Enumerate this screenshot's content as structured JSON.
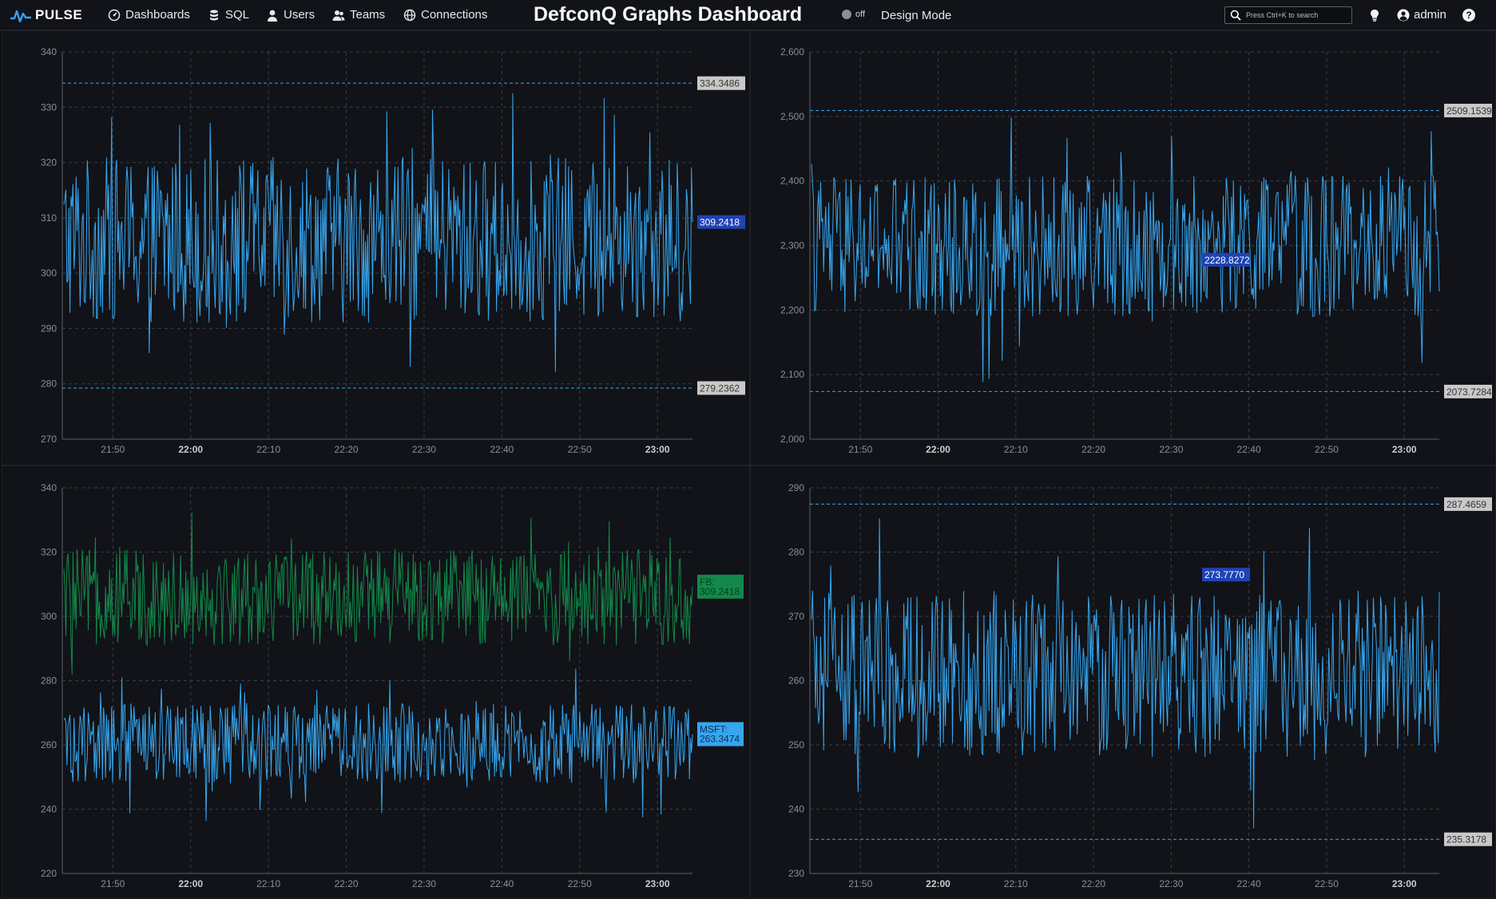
{
  "app": {
    "logo_text": "PULSE",
    "nav": [
      {
        "label": "Dashboards",
        "icon": "dashboard-icon"
      },
      {
        "label": "SQL",
        "icon": "database-icon"
      },
      {
        "label": "Users",
        "icon": "user-icon"
      },
      {
        "label": "Teams",
        "icon": "teams-icon"
      },
      {
        "label": "Connections",
        "icon": "globe-icon"
      }
    ],
    "title": "DefconQ Graphs Dashboard",
    "design_toggle_state": "off",
    "design_mode_label": "Design Mode",
    "search_placeholder": "Press Ctrl+K to search",
    "user_name": "admin",
    "colors": {
      "background": "#0e1014",
      "panel": "#111318",
      "series_blue": "#37a6ef",
      "series_green": "#12894a",
      "label_blue": "#1f43b5",
      "label_grey": "#c9c9c9"
    }
  },
  "chart_data": [
    {
      "type": "line",
      "x_ticks": [
        "21:50",
        "22:00",
        "22:10",
        "22:20",
        "22:30",
        "22:40",
        "22:50",
        "23:00"
      ],
      "x_bold_ticks": [
        "22:00",
        "23:00"
      ],
      "x_range": [
        "21:43:30",
        "23:04:30"
      ],
      "ylim": [
        270,
        340
      ],
      "y_ticks": [
        340,
        330,
        320,
        310,
        300,
        290,
        280,
        270
      ],
      "grid": true,
      "series": [
        {
          "color": "#37a6ef",
          "band": [
            291,
            321
          ],
          "spike_max": 334.3486,
          "spike_min": 279.2362,
          "last": 309.2418
        }
      ],
      "hlines": [
        334.3486,
        279.2362
      ],
      "labels": [
        {
          "value": 334.3486,
          "text": "334.3486",
          "style": "grey"
        },
        {
          "value": 309.2418,
          "text": "309.2418",
          "style": "blue"
        },
        {
          "value": 279.2362,
          "text": "279.2362",
          "style": "grey"
        }
      ]
    },
    {
      "type": "line",
      "x_ticks": [
        "21:50",
        "22:00",
        "22:10",
        "22:20",
        "22:30",
        "22:40",
        "22:50",
        "23:00"
      ],
      "x_bold_ticks": [
        "22:00",
        "23:00"
      ],
      "x_range": [
        "21:43:30",
        "23:04:30"
      ],
      "ylim": [
        2000,
        2600
      ],
      "y_ticks": [
        "2,600",
        "2,500",
        "2,400",
        "2,300",
        "2,200",
        "2,100",
        "2,000"
      ],
      "grid": true,
      "series": [
        {
          "color": "#37a6ef",
          "band": [
            2190,
            2410
          ],
          "spike_max": 2509.1539,
          "spike_min": 2073.7284,
          "last": 2228.8272
        }
      ],
      "hlines": [
        2509.1539,
        2073.7284
      ],
      "labels": [
        {
          "value": 2509.1539,
          "text": "2509.1539",
          "style": "grey"
        },
        {
          "value": 2073.7284,
          "text": "2073.7284",
          "style": "grey"
        },
        {
          "value": 2278,
          "time": "22:35",
          "text": "2228.8272",
          "style": "blue"
        }
      ]
    },
    {
      "type": "line",
      "x_ticks": [
        "21:50",
        "22:00",
        "22:10",
        "22:20",
        "22:30",
        "22:40",
        "22:50",
        "23:00"
      ],
      "x_bold_ticks": [
        "22:00",
        "23:00"
      ],
      "x_range": [
        "21:43:30",
        "23:04:30"
      ],
      "ylim": [
        220,
        340
      ],
      "y_ticks": [
        340,
        320,
        300,
        280,
        260,
        240,
        220
      ],
      "grid": true,
      "series": [
        {
          "name": "FB",
          "color": "#12894a",
          "band": [
            291,
            321
          ],
          "spike_max": 335,
          "spike_min": 279,
          "last": 309.2418
        },
        {
          "name": "MSFT",
          "color": "#37a6ef",
          "band": [
            248,
            273
          ],
          "spike_max": 284,
          "spike_min": 236,
          "last": 263.3474
        }
      ],
      "hlines": [],
      "labels": [
        {
          "value": 309.2418,
          "text": "FB:\n309.2418",
          "style": "green"
        },
        {
          "value": 263.3474,
          "text": "MSFT:\n263.3474",
          "style": "lightblue"
        }
      ]
    },
    {
      "type": "line",
      "x_ticks": [
        "21:50",
        "22:00",
        "22:10",
        "22:20",
        "22:30",
        "22:40",
        "22:50",
        "23:00"
      ],
      "x_bold_ticks": [
        "22:00",
        "23:00"
      ],
      "x_range": [
        "21:43:30",
        "23:04:30"
      ],
      "ylim": [
        230,
        290
      ],
      "y_ticks": [
        290,
        280,
        270,
        260,
        250,
        240,
        230
      ],
      "grid": true,
      "series": [
        {
          "color": "#37a6ef",
          "band": [
            248,
            274
          ],
          "spike_max": 287.4659,
          "spike_min": 235.3178,
          "last": 273.777
        }
      ],
      "hlines": [
        287.4659,
        235.3178
      ],
      "labels": [
        {
          "value": 287.4659,
          "text": "287.4659",
          "style": "grey"
        },
        {
          "value": 235.3178,
          "text": "235.3178",
          "style": "grey"
        },
        {
          "value": 276.5,
          "time": "22:35",
          "text": "273.7770",
          "style": "blue"
        }
      ]
    }
  ]
}
